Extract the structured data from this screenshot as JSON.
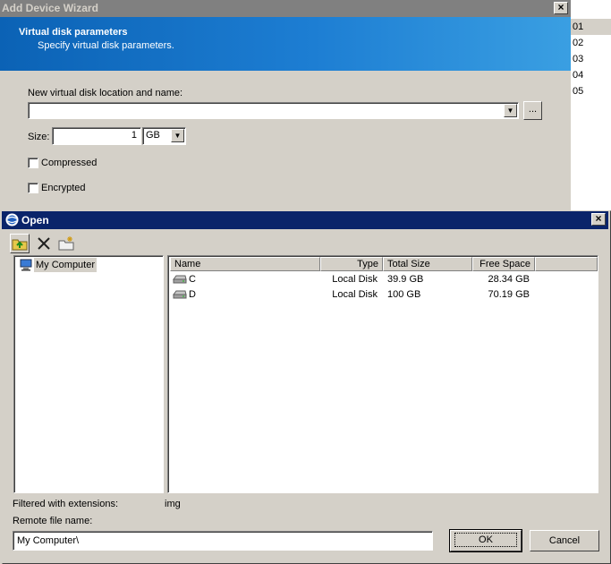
{
  "wizard": {
    "title": "Add Device Wizard",
    "header_title": "Virtual disk parameters",
    "header_subtitle": "Specify virtual disk parameters.",
    "location_label": "New virtual disk location and name:",
    "location_value": "",
    "browse_label": "...",
    "size_label": "Size:",
    "size_value": "1",
    "size_unit": "GB",
    "compressed_label": "Compressed",
    "encrypted_label": "Encrypted"
  },
  "background_table": {
    "rows": [
      "01",
      "02",
      "03",
      "04",
      "05"
    ]
  },
  "open_dialog": {
    "title": "Open",
    "tree": {
      "root_label": "My Computer"
    },
    "columns": {
      "name": "Name",
      "type": "Type",
      "total_size": "Total Size",
      "free_space": "Free Space"
    },
    "rows": [
      {
        "name": "C",
        "type": "Local Disk",
        "total_size": "39.9 GB",
        "free_space": "28.34 GB"
      },
      {
        "name": "D",
        "type": "Local Disk",
        "total_size": "100 GB",
        "free_space": "70.19 GB"
      }
    ],
    "filter_label": "Filtered with extensions:",
    "filter_value": "img",
    "remote_label": "Remote file name:",
    "remote_value": "My Computer\\",
    "ok_label": "OK",
    "cancel_label": "Cancel"
  },
  "colors": {
    "dialog_title_bg": "#0a246a",
    "inactive_title_bg": "#808080",
    "header_blue": "#1d7ed3",
    "face": "#d4d0c8"
  }
}
